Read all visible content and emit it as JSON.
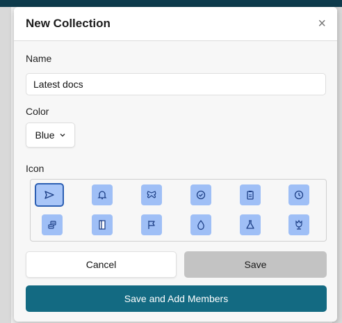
{
  "modal": {
    "title": "New Collection",
    "close_glyph": "×"
  },
  "name_field": {
    "label": "Name",
    "value": "Latest docs"
  },
  "color_field": {
    "label": "Color",
    "value": "Blue",
    "chevron": "chevron-down-icon"
  },
  "icon_field": {
    "label": "Icon",
    "selected": "paper-plane-icon",
    "icons": [
      "paper-plane-icon",
      "bell-icon",
      "butterfly-icon",
      "check-circle-icon",
      "clipboard-icon",
      "clock-icon",
      "coins-icon",
      "document-icon",
      "flag-icon",
      "drop-icon",
      "flask-icon",
      "flower-icon"
    ],
    "accent": "#9fbff6",
    "selected_border": "#2c5fb3"
  },
  "buttons": {
    "cancel": "Cancel",
    "save": "Save",
    "save_add": "Save and Add Members"
  },
  "colors": {
    "primary": "#136a82",
    "disabled": "#c3c3c3"
  }
}
